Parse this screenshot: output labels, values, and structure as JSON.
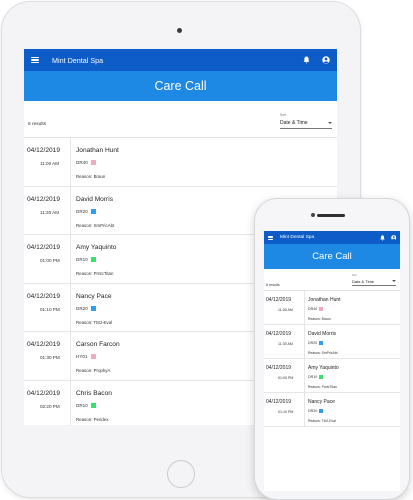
{
  "app": {
    "title": "Mint Dental Spa",
    "page_title": "Care Call",
    "results_text": "6 results",
    "sort_label": "Sort",
    "sort_value": "Date & Time",
    "icons": {
      "menu": "menu-icon",
      "notifications": "bell-icon",
      "account": "user-icon",
      "sort": "chevron-down-icon"
    },
    "colors": {
      "appbar": "#0d5cc7",
      "banner": "#1e88e5",
      "pink": "#f2a7c4",
      "blue": "#2aa1f0",
      "green": "#35e36a"
    }
  },
  "appointments": [
    {
      "date": "04/12/2019",
      "time": "11:00 AM",
      "name": "Jonathan Hunt",
      "provider": "DR40",
      "swatch": "#f2a7c4",
      "reason": "Reason: Braun"
    },
    {
      "date": "04/12/2019",
      "time": "11:30 AM",
      "name": "David Morris",
      "provider": "DR20",
      "swatch": "#2aa1f0",
      "reason": "Reason: SmPricAbt"
    },
    {
      "date": "04/12/2019",
      "time": "01:00 PM",
      "name": "Amy Yaquinto",
      "provider": "DR10",
      "swatch": "#35e36a",
      "reason": "Reason: PrntcTitan"
    },
    {
      "date": "04/12/2019",
      "time": "01:10 PM",
      "name": "Nancy Pace",
      "provider": "DR20",
      "swatch": "#2aa1f0",
      "reason": "Reason: TMJ-Eval"
    },
    {
      "date": "04/12/2019",
      "time": "01:30 PM",
      "name": "Carson Farcon",
      "provider": "HY01",
      "swatch": "#f2a7c4",
      "reason": "Reason: ProphyA"
    },
    {
      "date": "04/12/2019",
      "time": "02:20 PM",
      "name": "Chris Bacon",
      "provider": "DR10",
      "swatch": "#35e36a",
      "reason": "Reason: Peridex"
    }
  ]
}
